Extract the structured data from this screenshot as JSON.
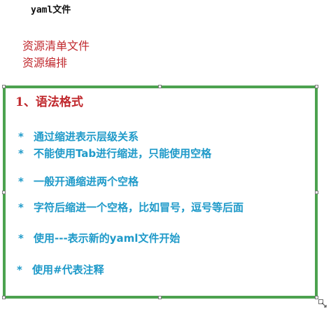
{
  "header": {
    "title": "yaml文件"
  },
  "notes": [
    "资源清单文件",
    "资源编排"
  ],
  "slide": {
    "section_title": "1、语法格式",
    "bullet_symbol": "*",
    "bullets": [
      "通过缩进表示层级关系",
      "不能使用Tab进行缩进，只能使用空格",
      "一般开通缩进两个空格",
      "字符后缩进一个空格，比如冒号，逗号等后面",
      "使用---表示新的yaml文件开始",
      "使用#代表注释"
    ]
  },
  "colors": {
    "title": "#111111",
    "notes": "#c0282d",
    "section_title": "#c0282d",
    "bullets": "#1f9ac9",
    "frame_border": "#4ca24f"
  },
  "icons": {
    "resize_grip": "resize-grip-icon"
  }
}
